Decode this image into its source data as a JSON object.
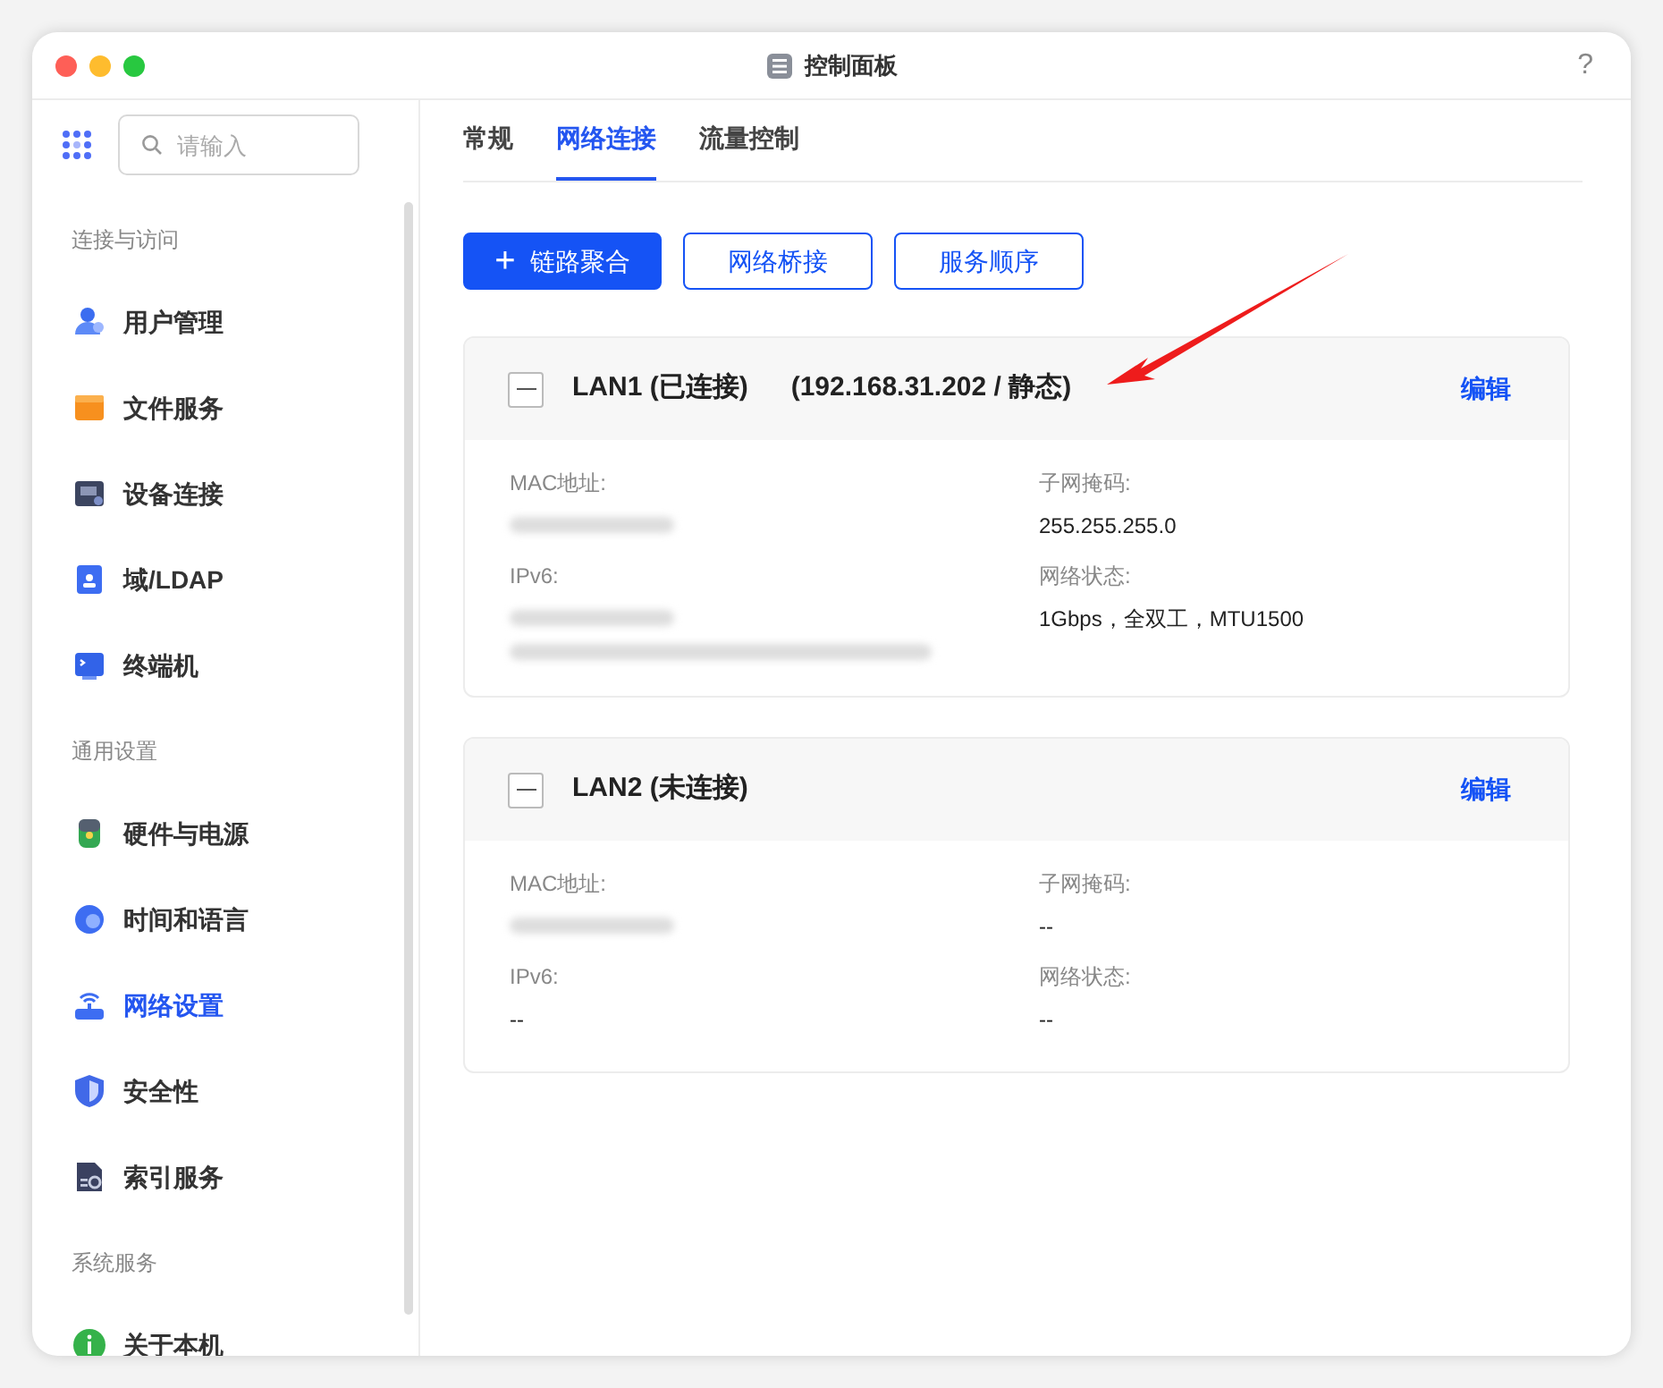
{
  "window": {
    "title": "控制面板",
    "help": "?"
  },
  "sidebar": {
    "search": {
      "placeholder": "请输入"
    },
    "sections": [
      {
        "title": "连接与访问",
        "items": [
          {
            "label": "用户管理",
            "selected": false
          },
          {
            "label": "文件服务",
            "selected": false
          },
          {
            "label": "设备连接",
            "selected": false
          },
          {
            "label": "域/LDAP",
            "selected": false
          },
          {
            "label": "终端机",
            "selected": false
          }
        ]
      },
      {
        "title": "通用设置",
        "items": [
          {
            "label": "硬件与电源",
            "selected": false
          },
          {
            "label": "时间和语言",
            "selected": false
          },
          {
            "label": "网络设置",
            "selected": true
          },
          {
            "label": "安全性",
            "selected": false
          },
          {
            "label": "索引服务",
            "selected": false
          }
        ]
      },
      {
        "title": "系统服务",
        "items": [
          {
            "label": "关于本机",
            "selected": false
          }
        ]
      }
    ]
  },
  "tabs": [
    {
      "label": "常规",
      "selected": false
    },
    {
      "label": "网络连接",
      "selected": true
    },
    {
      "label": "流量控制",
      "selected": false
    }
  ],
  "actions": [
    {
      "label": "链路聚合",
      "kind": "primary",
      "icon": "+"
    },
    {
      "label": "网络桥接",
      "kind": "outline"
    },
    {
      "label": "服务顺序",
      "kind": "outline"
    }
  ],
  "interfaces": [
    {
      "title": "LAN1 (已连接)",
      "address": "(192.168.31.202 / 静态)",
      "edit": "编辑",
      "expanded": true,
      "fields": [
        {
          "label": "MAC地址:",
          "values": [
            {
              "kind": "blurred"
            }
          ]
        },
        {
          "label": "子网掩码:",
          "values": [
            {
              "kind": "text",
              "text": "255.255.255.0"
            }
          ]
        },
        {
          "label": "IPv6:",
          "values": [
            {
              "kind": "blurred"
            },
            {
              "kind": "blurred-long"
            }
          ]
        },
        {
          "label": "网络状态:",
          "values": [
            {
              "kind": "text",
              "text": "1Gbps，全双工，MTU1500"
            }
          ]
        }
      ]
    },
    {
      "title": "LAN2 (未连接)",
      "edit": "编辑",
      "expanded": true,
      "fields": [
        {
          "label": "MAC地址:",
          "values": [
            {
              "kind": "blurred"
            }
          ]
        },
        {
          "label": "子网掩码:",
          "values": [
            {
              "kind": "text",
              "text": "--"
            }
          ]
        },
        {
          "label": "IPv6:",
          "values": [
            {
              "kind": "text",
              "text": "--"
            }
          ]
        },
        {
          "label": "网络状态:",
          "values": [
            {
              "kind": "text",
              "text": "--"
            }
          ]
        }
      ]
    }
  ]
}
